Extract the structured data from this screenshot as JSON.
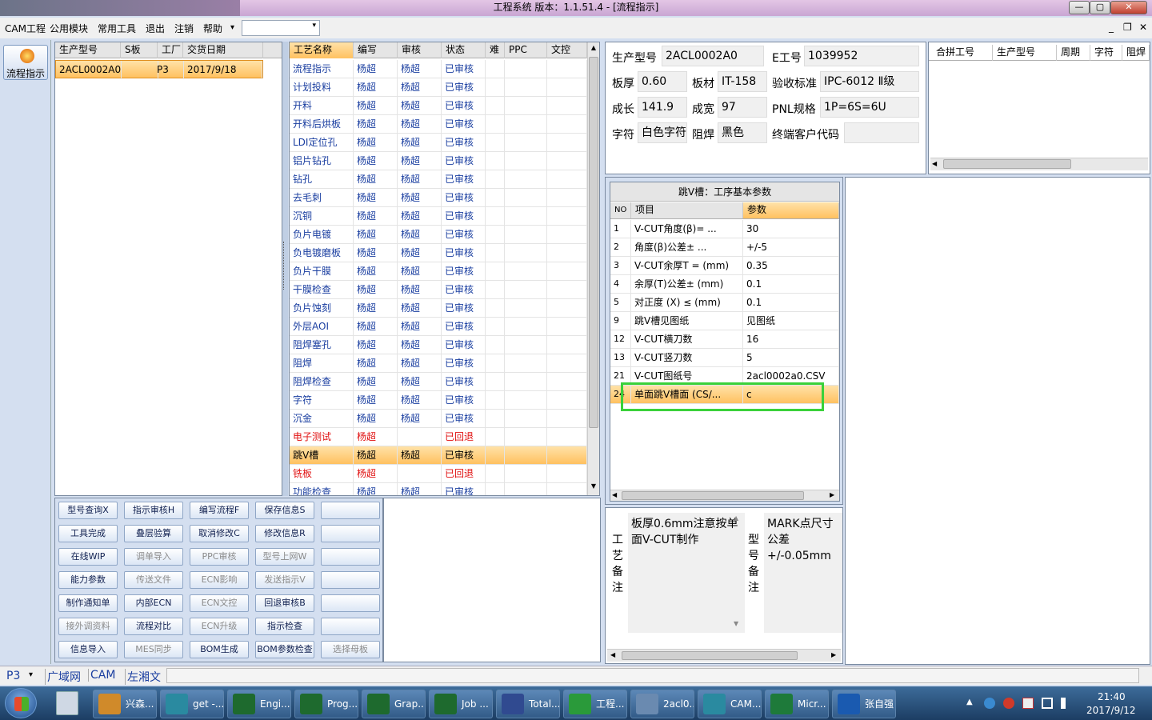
{
  "window": {
    "title": "工程系统   版本：1.1.51.4 - [流程指示]",
    "btn_min": "—",
    "btn_max": "▢",
    "btn_close": "✕"
  },
  "menu": {
    "items": [
      "CAM工程",
      "公用模块",
      "常用工具",
      "退出",
      "注销",
      "帮助"
    ],
    "help_arrow": "▾",
    "combo_value": "",
    "mdi_min": "_",
    "mdi_restore": "❐",
    "mdi_close": "✕"
  },
  "sidebar": {
    "item_label": "流程指示"
  },
  "orders": {
    "columns": [
      "生产型号",
      "S板",
      "工厂",
      "交货日期"
    ],
    "rows": [
      {
        "model": "2ACL0002A0",
        "s": "",
        "factory": "P3",
        "date": "2017/9/18"
      }
    ]
  },
  "process": {
    "columns": [
      "工艺名称",
      "编写",
      "审核",
      "状态",
      "难",
      "PPC",
      "文控"
    ],
    "rows": [
      {
        "name": "流程指示",
        "writer": "杨超",
        "reviewer": "杨超",
        "status": "已审核",
        "state": "ok"
      },
      {
        "name": "计划投料",
        "writer": "杨超",
        "reviewer": "杨超",
        "status": "已审核",
        "state": "ok"
      },
      {
        "name": "开料",
        "writer": "杨超",
        "reviewer": "杨超",
        "status": "已审核",
        "state": "ok"
      },
      {
        "name": "开料后烘板",
        "writer": "杨超",
        "reviewer": "杨超",
        "status": "已审核",
        "state": "ok"
      },
      {
        "name": "LDI定位孔",
        "writer": "杨超",
        "reviewer": "杨超",
        "status": "已审核",
        "state": "ok"
      },
      {
        "name": "铝片钻孔",
        "writer": "杨超",
        "reviewer": "杨超",
        "status": "已审核",
        "state": "ok"
      },
      {
        "name": "钻孔",
        "writer": "杨超",
        "reviewer": "杨超",
        "status": "已审核",
        "state": "ok"
      },
      {
        "name": "去毛刺",
        "writer": "杨超",
        "reviewer": "杨超",
        "status": "已审核",
        "state": "ok"
      },
      {
        "name": "沉铜",
        "writer": "杨超",
        "reviewer": "杨超",
        "status": "已审核",
        "state": "ok"
      },
      {
        "name": "负片电镀",
        "writer": "杨超",
        "reviewer": "杨超",
        "status": "已审核",
        "state": "ok"
      },
      {
        "name": "负电镀磨板",
        "writer": "杨超",
        "reviewer": "杨超",
        "status": "已审核",
        "state": "ok"
      },
      {
        "name": "负片干膜",
        "writer": "杨超",
        "reviewer": "杨超",
        "status": "已审核",
        "state": "ok"
      },
      {
        "name": "干膜检查",
        "writer": "杨超",
        "reviewer": "杨超",
        "status": "已审核",
        "state": "ok"
      },
      {
        "name": "负片蚀刻",
        "writer": "杨超",
        "reviewer": "杨超",
        "status": "已审核",
        "state": "ok"
      },
      {
        "name": "外层AOI",
        "writer": "杨超",
        "reviewer": "杨超",
        "status": "已审核",
        "state": "ok"
      },
      {
        "name": "阻焊塞孔",
        "writer": "杨超",
        "reviewer": "杨超",
        "status": "已审核",
        "state": "ok"
      },
      {
        "name": "阻焊",
        "writer": "杨超",
        "reviewer": "杨超",
        "status": "已审核",
        "state": "ok"
      },
      {
        "name": "阻焊检查",
        "writer": "杨超",
        "reviewer": "杨超",
        "status": "已审核",
        "state": "ok"
      },
      {
        "name": "字符",
        "writer": "杨超",
        "reviewer": "杨超",
        "status": "已审核",
        "state": "ok"
      },
      {
        "name": "沉金",
        "writer": "杨超",
        "reviewer": "杨超",
        "status": "已审核",
        "state": "ok"
      },
      {
        "name": "电子测试",
        "writer": "杨超",
        "reviewer": "",
        "status": "已回退",
        "state": "back"
      },
      {
        "name": "跳V槽",
        "writer": "杨超",
        "reviewer": "杨超",
        "status": "已审核",
        "state": "selected"
      },
      {
        "name": "铣板",
        "writer": "杨超",
        "reviewer": "",
        "status": "已回退",
        "state": "back"
      },
      {
        "name": "功能检查",
        "writer": "杨超",
        "reviewer": "杨超",
        "status": "已审核",
        "state": "ok"
      }
    ]
  },
  "buttons": [
    [
      "型号查询X",
      "指示审核H",
      "编写流程F",
      "保存信息S",
      ""
    ],
    [
      "工具完成",
      "叠层验算",
      "取消修改C",
      "修改信息R",
      ""
    ],
    [
      "在线WIP",
      "调单导入",
      "PPC审核",
      "型号上网W",
      ""
    ],
    [
      "能力参数",
      "传送文件",
      "ECN影响",
      "发送指示V",
      ""
    ],
    [
      "制作通知单",
      "内部ECN",
      "ECN文控",
      "回退审核B",
      ""
    ],
    [
      "接外调资料",
      "流程对比",
      "ECN升级",
      "指示检查",
      ""
    ],
    [
      "信息导入",
      "MES同步",
      "BOM生成",
      "BOM参数检查",
      "选择母板"
    ]
  ],
  "buttons_disabled": [
    [
      false,
      false,
      false,
      false,
      false
    ],
    [
      false,
      false,
      false,
      false,
      false
    ],
    [
      false,
      true,
      true,
      true,
      false
    ],
    [
      false,
      true,
      true,
      true,
      false
    ],
    [
      false,
      false,
      true,
      false,
      false
    ],
    [
      true,
      false,
      true,
      false,
      false
    ],
    [
      false,
      true,
      false,
      false,
      true
    ]
  ],
  "info": {
    "model_label": "生产型号",
    "model_value": "2ACL0002A0",
    "eno_label": "E工号",
    "eno_value": "1039952",
    "thick_label": "板厚",
    "thick_value": "0.60",
    "material_label": "板材",
    "material_value": "IT-158",
    "standard_label": "验收标准",
    "standard_value": "IPC-6012 Ⅱ级",
    "len_label": "成长",
    "len_value": "141.9",
    "wid_label": "成宽",
    "wid_value": "97",
    "pnl_label": "PNL规格",
    "pnl_value": "1P=6S=6U",
    "char_label": "字符",
    "char_value": "白色字符",
    "mask_label": "阻焊",
    "mask_value": "黑色",
    "cust_label": "终端客户代码",
    "cust_value": ""
  },
  "merge": {
    "columns": [
      "合拼工号",
      "生产型号",
      "周期",
      "字符",
      "阻焊"
    ]
  },
  "params": {
    "title": "跳V槽：工序基本参数",
    "columns": [
      "NO",
      "项目",
      "参数"
    ],
    "rows": [
      {
        "no": "1",
        "item": "V-CUT角度(β)=  ...",
        "value": "30"
      },
      {
        "no": "2",
        "item": "角度(β)公差±  ...",
        "value": "+/-5"
      },
      {
        "no": "3",
        "item": "V-CUT余厚T =  (mm)",
        "value": "0.35"
      },
      {
        "no": "4",
        "item": "余厚(T)公差±  (mm)",
        "value": "0.1"
      },
      {
        "no": "5",
        "item": "对正度 (X) ≤ (mm)",
        "value": "0.1"
      },
      {
        "no": "9",
        "item": "跳V槽见图纸",
        "value": "见图纸"
      },
      {
        "no": "12",
        "item": "V-CUT横刀数",
        "value": "16"
      },
      {
        "no": "13",
        "item": "V-CUT竖刀数",
        "value": "5"
      },
      {
        "no": "21",
        "item": "V-CUT图纸号",
        "value": "2acl0002a0.CSV"
      },
      {
        "no": "24",
        "item": "单面跳V槽面 (CS/...",
        "value": "c"
      }
    ]
  },
  "notes": {
    "process_label": [
      "工",
      "艺",
      "备",
      "注"
    ],
    "process_text": "板厚0.6mm注意按单面V-CUT制作",
    "model_label": [
      "型",
      "号",
      "备",
      "注"
    ],
    "model_text": "MARK点尺寸公差+/-0.05mm"
  },
  "status": {
    "factory": "P3",
    "tabs": [
      "广域网",
      "CAM",
      "左湘文"
    ]
  },
  "taskbar": {
    "items": [
      {
        "label": "兴森...",
        "color": "#d08a2a"
      },
      {
        "label": "get -...",
        "color": "#2a8aa0"
      },
      {
        "label": "Engi...",
        "color": "#1e6a2e"
      },
      {
        "label": "Prog...",
        "color": "#1e6a2e"
      },
      {
        "label": "Grap...",
        "color": "#1e6a2e"
      },
      {
        "label": "Job ...",
        "color": "#1e6a2e"
      },
      {
        "label": "Total...",
        "color": "#304a90"
      },
      {
        "label": "工程...",
        "color": "#2a9a3a"
      },
      {
        "label": "2acl0...",
        "color": "#6a8ab0"
      },
      {
        "label": "CAM...",
        "color": "#2a8aa0"
      },
      {
        "label": "Micr...",
        "color": "#1e7a3a"
      },
      {
        "label": "张自强",
        "color": "#1a5ab0"
      }
    ],
    "time": "21:40",
    "date": "2017/9/12"
  }
}
